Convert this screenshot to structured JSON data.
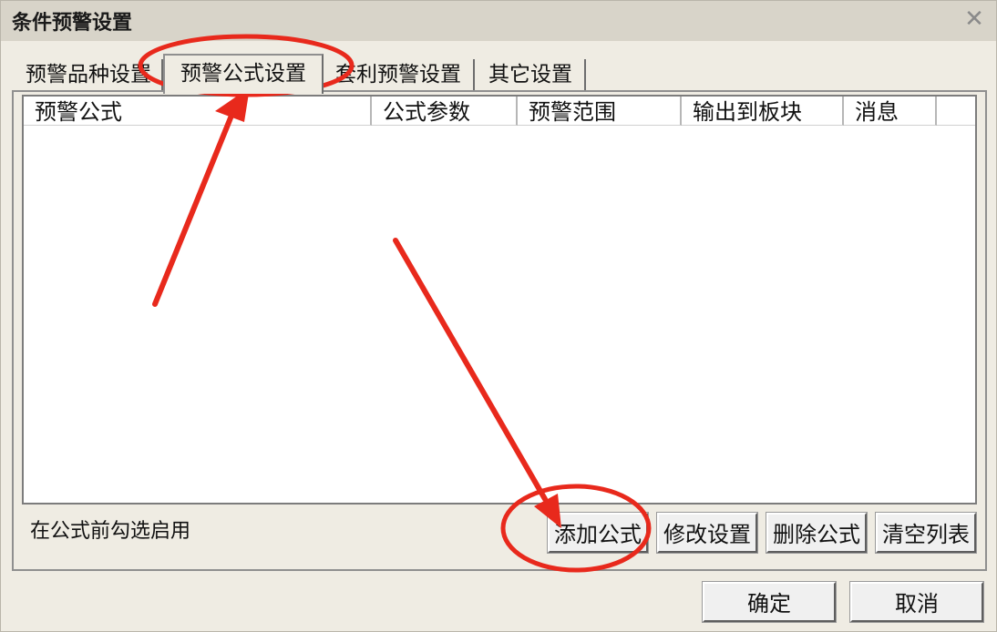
{
  "window": {
    "title": "条件预警设置",
    "close_symbol": "✕"
  },
  "tabs": [
    {
      "label": "预警品种设置"
    },
    {
      "label": "预警公式设置"
    },
    {
      "label": "套利预警设置"
    },
    {
      "label": "其它设置"
    }
  ],
  "table": {
    "columns": [
      "预警公式",
      "公式参数",
      "预警范围",
      "输出到板块",
      "消息"
    ]
  },
  "hint": "在公式前勾选启用",
  "buttons": {
    "add": "添加公式",
    "modify": "修改设置",
    "delete": "删除公式",
    "clear": "清空列表",
    "ok": "确定",
    "cancel": "取消"
  },
  "colors": {
    "annotation": "#e8291c"
  }
}
